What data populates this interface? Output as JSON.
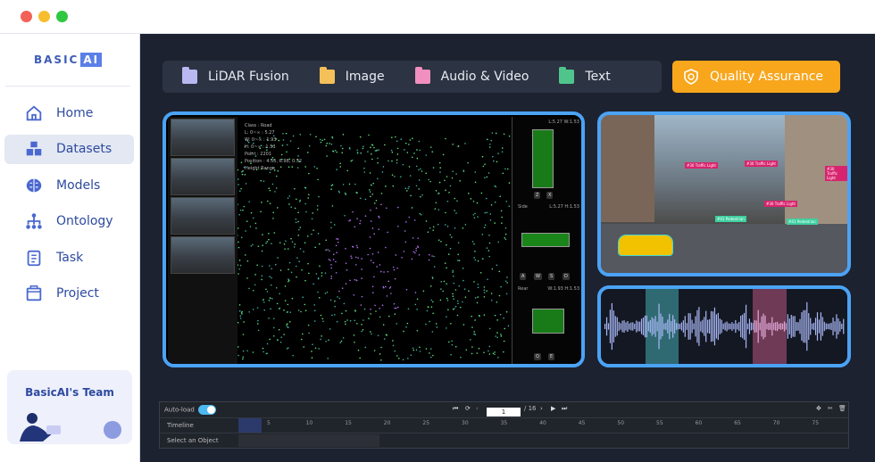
{
  "window": {
    "controls": [
      "close",
      "minimize",
      "maximize"
    ],
    "colors": [
      "#f26157",
      "#f7bd2e",
      "#2fc840"
    ]
  },
  "sidebar": {
    "logo": {
      "text": "BASIC",
      "ai": "AI"
    },
    "items": [
      {
        "label": "Home",
        "icon": "home-icon"
      },
      {
        "label": "Datasets",
        "icon": "cubes-icon",
        "active": true
      },
      {
        "label": "Models",
        "icon": "brain-icon"
      },
      {
        "label": "Ontology",
        "icon": "hierarchy-icon"
      },
      {
        "label": "Task",
        "icon": "clipboard-icon"
      },
      {
        "label": "Project",
        "icon": "folder-icon"
      }
    ],
    "team": {
      "title": "BasicAI's Team"
    }
  },
  "tabs": [
    {
      "label": "LiDAR Fusion",
      "color": "#b9b8f0"
    },
    {
      "label": "Image",
      "color": "#f4c05a"
    },
    {
      "label": "Audio & Video",
      "color": "#f08fc0"
    },
    {
      "label": "Text",
      "color": "#4fc58c"
    }
  ],
  "qa_button": {
    "label": "Quality Assurance",
    "color": "#f8a61c"
  },
  "lidar": {
    "info": [
      "Class : Road",
      "L: 0~∞ : 5.27",
      "W: 0~∞ : 1.93",
      "H: 0~∞ : 1.53",
      "Point : 2201",
      "Position : 4.55, 6.98, 0.32",
      "Height Range"
    ],
    "views": [
      {
        "label": "",
        "dims": "L:5.27 W:1.53"
      },
      {
        "label": "Side",
        "dims": "L:5.27 H:1.53"
      },
      {
        "label": "Rear",
        "dims": "W:1.93 H:1.53"
      }
    ],
    "buttons": [
      [
        "Z",
        "X"
      ],
      [
        "A",
        "W",
        "S",
        "D"
      ],
      [
        "Q",
        "E"
      ]
    ]
  },
  "camera": {
    "tags": [
      "#30 Traffic Light",
      "#30 Traffic Light",
      "#30 Traffic Light",
      "#30 Traffic Light",
      "#41 Pedestrian",
      "#41 Pedestrian",
      "#41 Pedestrian"
    ]
  },
  "timeline": {
    "autoload_label": "Auto-load",
    "autoload_on": true,
    "page": "1",
    "page_total": "/ 16",
    "row_timeline": "Timeline",
    "row_object": "Select an Object",
    "ticks": [
      "5",
      "10",
      "15",
      "20",
      "25",
      "30",
      "35",
      "40",
      "45",
      "50",
      "55",
      "60",
      "65",
      "70",
      "75"
    ]
  }
}
